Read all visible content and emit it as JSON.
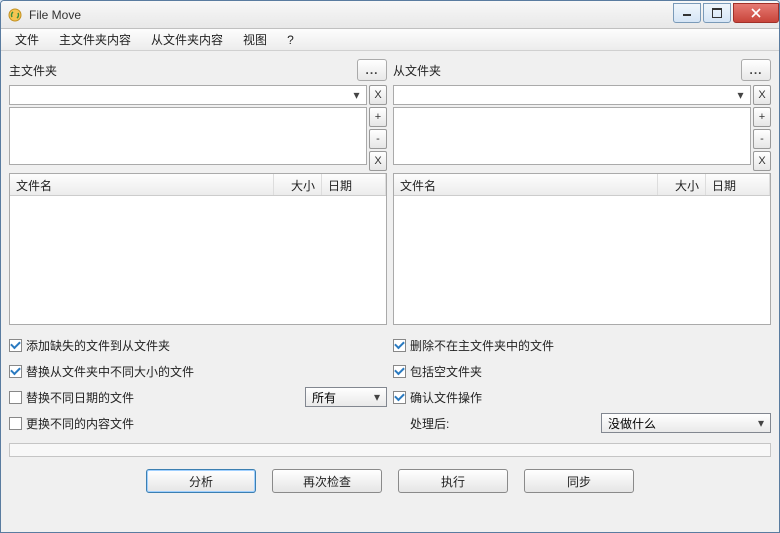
{
  "window": {
    "title": "File Move"
  },
  "menu": {
    "file": "文件",
    "master": "主文件夹内容",
    "slave": "从文件夹内容",
    "view": "视图",
    "help": "?"
  },
  "browse": "...",
  "btn": {
    "x": "X",
    "plus": "+",
    "minus": "-"
  },
  "left": {
    "label": "主文件夹",
    "columns": {
      "filename": "文件名",
      "size": "大小",
      "date": "日期"
    },
    "options": {
      "add_missing": "添加缺失的文件到从文件夹",
      "replace_diff_size": "替换从文件夹中不同大小的文件",
      "replace_diff_date": "替换不同日期的文件",
      "replace_diff_content": "更换不同的内容文件",
      "date_mode": "所有"
    }
  },
  "right": {
    "label": "从文件夹",
    "columns": {
      "filename": "文件名",
      "size": "大小",
      "date": "日期"
    },
    "options": {
      "delete_not_in_master": "删除不在主文件夹中的文件",
      "include_empty": "包括空文件夹",
      "confirm_ops": "确认文件操作",
      "after_label": "处理后:",
      "after_action": "没做什么"
    }
  },
  "buttons": {
    "analyze": "分析",
    "recheck": "再次检查",
    "execute": "执行",
    "sync": "同步"
  }
}
